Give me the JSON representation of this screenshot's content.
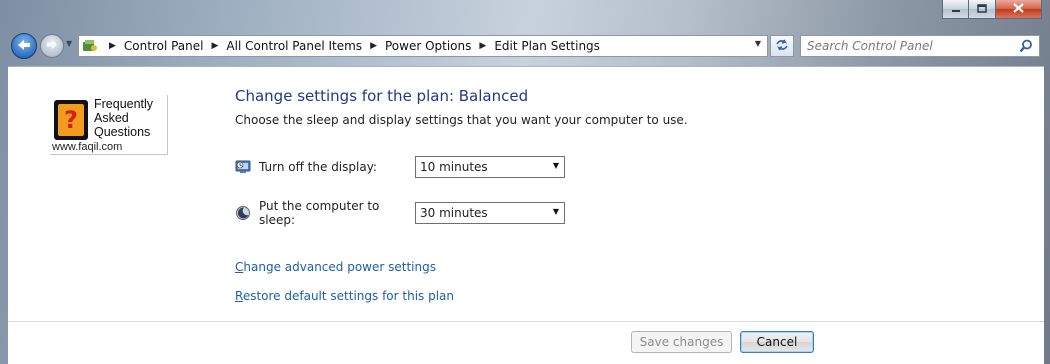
{
  "window": {
    "minimize_icon": "minimize-icon",
    "maximize_icon": "maximize-icon",
    "close_icon": "close-icon"
  },
  "address_bar": {
    "breadcrumbs": [
      "Control Panel",
      "All Control Panel Items",
      "Power Options",
      "Edit Plan Settings"
    ]
  },
  "search": {
    "placeholder": "Search Control Panel"
  },
  "logo": {
    "lines": [
      "Frequently",
      "Asked",
      "Questions"
    ],
    "url": "www.faqil.com"
  },
  "main": {
    "heading": "Change settings for the plan: Balanced",
    "subtext": "Choose the sleep and display settings that you want your computer to use.",
    "settings": [
      {
        "label": "Turn off the display:",
        "value": "10 minutes",
        "icon": "display-icon"
      },
      {
        "label": "Put the computer to sleep:",
        "value": "30 minutes",
        "icon": "sleep-moon-icon"
      }
    ],
    "links": {
      "advanced_first": "C",
      "advanced_rest": "hange advanced power settings",
      "restore_first": "R",
      "restore_rest": "estore default settings for this plan"
    }
  },
  "footer": {
    "save_label": "Save changes",
    "cancel_label": "Cancel"
  },
  "colors": {
    "heading": "#1e3a8a",
    "link": "#1c5fad",
    "accent": "#2f6fc0"
  }
}
